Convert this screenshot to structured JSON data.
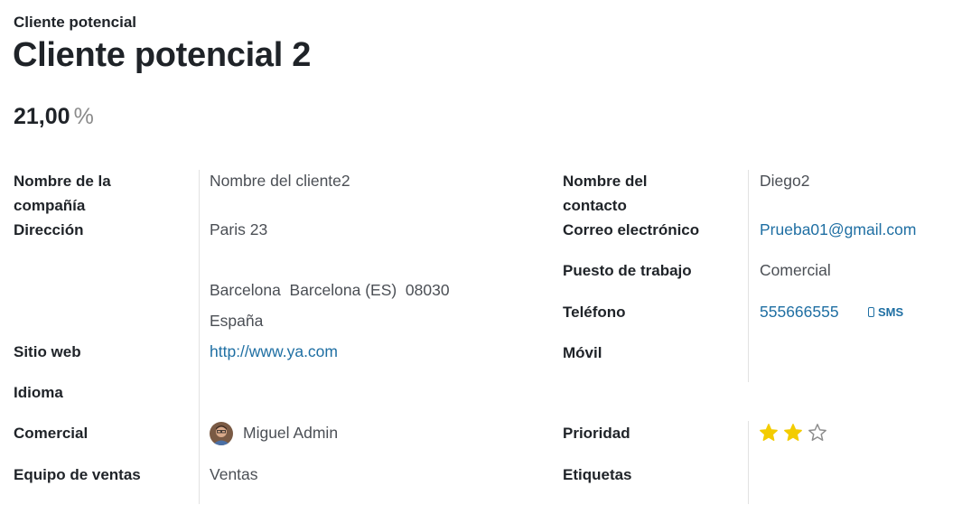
{
  "header": {
    "subtitle": "Cliente potencial",
    "title": "Cliente potencial 2",
    "probability": "21,00",
    "probability_unit": "%"
  },
  "left": {
    "company_label": "Nombre de la compañía",
    "company_value": "Nombre del cliente2",
    "address_label": "Dirección",
    "street": "Paris 23",
    "street2": "",
    "city_line": "Barcelona  Barcelona (ES)  08030",
    "country": "España",
    "website_label": "Sitio web",
    "website_value": "http://www.ya.com",
    "language_label": "Idioma",
    "language_value": "",
    "salesperson_label": "Comercial",
    "salesperson_value": "Miguel Admin",
    "team_label": "Equipo de ventas",
    "team_value": "Ventas"
  },
  "right": {
    "contact_label": "Nombre del contacto",
    "contact_value": "Diego2",
    "email_label": "Correo electrónico",
    "email_value": "Prueba01@gmail.com",
    "job_label": "Puesto de trabajo",
    "job_value": "Comercial",
    "phone_label": "Teléfono",
    "phone_value": "555666555",
    "sms_label": "SMS",
    "mobile_label": "Móvil",
    "mobile_value": "",
    "priority_label": "Prioridad",
    "priority_value": 2,
    "priority_max": 3,
    "tags_label": "Etiquetas"
  },
  "colors": {
    "link": "#1f6fa3",
    "star_filled": "#f3cc00",
    "star_empty": "#8d8d8d"
  }
}
